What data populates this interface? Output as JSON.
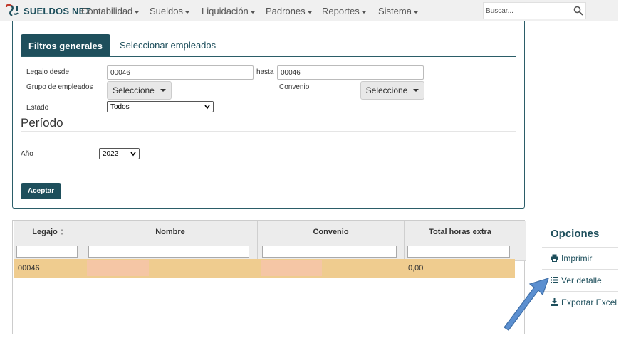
{
  "app": {
    "logo_text": "SUELDOS NET"
  },
  "nav": {
    "items": [
      {
        "label": "Contabilidad"
      },
      {
        "label": "Sueldos"
      },
      {
        "label": "Liquidación"
      },
      {
        "label": "Padrones"
      },
      {
        "label": "Reportes"
      },
      {
        "label": "Sistema"
      }
    ],
    "search_placeholder": "Buscar..."
  },
  "tabs": {
    "active": "Filtros generales",
    "other": "Seleccionar empleados"
  },
  "filters": {
    "legajo_desde_label": "Legajo desde",
    "legajo_desde_value": "00046",
    "hasta_label": "hasta",
    "hasta_value": "00046",
    "grupo_label": "Grupo de empleados",
    "grupo_button": "Seleccione",
    "convenio_label": "Convenio",
    "convenio_button": "Seleccione",
    "estado_label": "Estado",
    "estado_value": "Todos"
  },
  "periodo": {
    "title": "Período",
    "anio_label": "Año",
    "anio_value": "2022"
  },
  "accept_label": "Aceptar",
  "grid": {
    "columns": [
      "Legajo",
      "Nombre",
      "Convenio",
      "Total horas extra"
    ],
    "rows": [
      {
        "legajo": "00046",
        "nombre": "",
        "convenio": "",
        "total_horas_extra": "0,00"
      }
    ]
  },
  "options": {
    "title": "Opciones",
    "items": [
      {
        "label": "Imprimir",
        "icon": "print-icon"
      },
      {
        "label": "Ver detalle",
        "icon": "list-icon"
      },
      {
        "label": "Exportar Excel",
        "icon": "download-icon"
      }
    ]
  },
  "colors": {
    "primary": "#1e4f5c",
    "row_highlight": "#efcc8f",
    "redaction": "#f5c6a5",
    "arrow": "#5b8fd0"
  }
}
